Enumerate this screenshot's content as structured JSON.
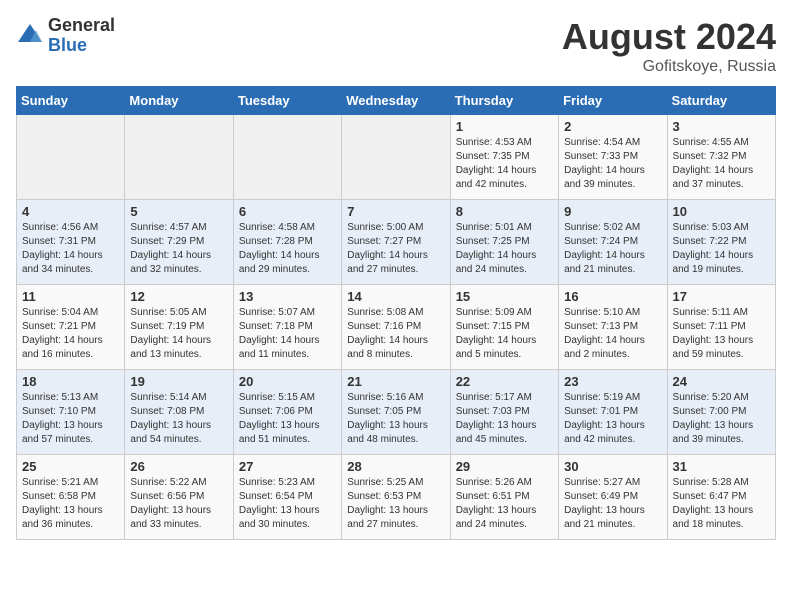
{
  "header": {
    "logo_general": "General",
    "logo_blue": "Blue",
    "month_year": "August 2024",
    "location": "Gofitskoye, Russia"
  },
  "weekdays": [
    "Sunday",
    "Monday",
    "Tuesday",
    "Wednesday",
    "Thursday",
    "Friday",
    "Saturday"
  ],
  "weeks": [
    [
      {
        "day": "",
        "empty": true
      },
      {
        "day": "",
        "empty": true
      },
      {
        "day": "",
        "empty": true
      },
      {
        "day": "",
        "empty": true
      },
      {
        "day": "1",
        "sunrise": "4:53 AM",
        "sunset": "7:35 PM",
        "daylight": "14 hours and 42 minutes."
      },
      {
        "day": "2",
        "sunrise": "4:54 AM",
        "sunset": "7:33 PM",
        "daylight": "14 hours and 39 minutes."
      },
      {
        "day": "3",
        "sunrise": "4:55 AM",
        "sunset": "7:32 PM",
        "daylight": "14 hours and 37 minutes."
      }
    ],
    [
      {
        "day": "4",
        "sunrise": "4:56 AM",
        "sunset": "7:31 PM",
        "daylight": "14 hours and 34 minutes."
      },
      {
        "day": "5",
        "sunrise": "4:57 AM",
        "sunset": "7:29 PM",
        "daylight": "14 hours and 32 minutes."
      },
      {
        "day": "6",
        "sunrise": "4:58 AM",
        "sunset": "7:28 PM",
        "daylight": "14 hours and 29 minutes."
      },
      {
        "day": "7",
        "sunrise": "5:00 AM",
        "sunset": "7:27 PM",
        "daylight": "14 hours and 27 minutes."
      },
      {
        "day": "8",
        "sunrise": "5:01 AM",
        "sunset": "7:25 PM",
        "daylight": "14 hours and 24 minutes."
      },
      {
        "day": "9",
        "sunrise": "5:02 AM",
        "sunset": "7:24 PM",
        "daylight": "14 hours and 21 minutes."
      },
      {
        "day": "10",
        "sunrise": "5:03 AM",
        "sunset": "7:22 PM",
        "daylight": "14 hours and 19 minutes."
      }
    ],
    [
      {
        "day": "11",
        "sunrise": "5:04 AM",
        "sunset": "7:21 PM",
        "daylight": "14 hours and 16 minutes."
      },
      {
        "day": "12",
        "sunrise": "5:05 AM",
        "sunset": "7:19 PM",
        "daylight": "14 hours and 13 minutes."
      },
      {
        "day": "13",
        "sunrise": "5:07 AM",
        "sunset": "7:18 PM",
        "daylight": "14 hours and 11 minutes."
      },
      {
        "day": "14",
        "sunrise": "5:08 AM",
        "sunset": "7:16 PM",
        "daylight": "14 hours and 8 minutes."
      },
      {
        "day": "15",
        "sunrise": "5:09 AM",
        "sunset": "7:15 PM",
        "daylight": "14 hours and 5 minutes."
      },
      {
        "day": "16",
        "sunrise": "5:10 AM",
        "sunset": "7:13 PM",
        "daylight": "14 hours and 2 minutes."
      },
      {
        "day": "17",
        "sunrise": "5:11 AM",
        "sunset": "7:11 PM",
        "daylight": "13 hours and 59 minutes."
      }
    ],
    [
      {
        "day": "18",
        "sunrise": "5:13 AM",
        "sunset": "7:10 PM",
        "daylight": "13 hours and 57 minutes."
      },
      {
        "day": "19",
        "sunrise": "5:14 AM",
        "sunset": "7:08 PM",
        "daylight": "13 hours and 54 minutes."
      },
      {
        "day": "20",
        "sunrise": "5:15 AM",
        "sunset": "7:06 PM",
        "daylight": "13 hours and 51 minutes."
      },
      {
        "day": "21",
        "sunrise": "5:16 AM",
        "sunset": "7:05 PM",
        "daylight": "13 hours and 48 minutes."
      },
      {
        "day": "22",
        "sunrise": "5:17 AM",
        "sunset": "7:03 PM",
        "daylight": "13 hours and 45 minutes."
      },
      {
        "day": "23",
        "sunrise": "5:19 AM",
        "sunset": "7:01 PM",
        "daylight": "13 hours and 42 minutes."
      },
      {
        "day": "24",
        "sunrise": "5:20 AM",
        "sunset": "7:00 PM",
        "daylight": "13 hours and 39 minutes."
      }
    ],
    [
      {
        "day": "25",
        "sunrise": "5:21 AM",
        "sunset": "6:58 PM",
        "daylight": "13 hours and 36 minutes."
      },
      {
        "day": "26",
        "sunrise": "5:22 AM",
        "sunset": "6:56 PM",
        "daylight": "13 hours and 33 minutes."
      },
      {
        "day": "27",
        "sunrise": "5:23 AM",
        "sunset": "6:54 PM",
        "daylight": "13 hours and 30 minutes."
      },
      {
        "day": "28",
        "sunrise": "5:25 AM",
        "sunset": "6:53 PM",
        "daylight": "13 hours and 27 minutes."
      },
      {
        "day": "29",
        "sunrise": "5:26 AM",
        "sunset": "6:51 PM",
        "daylight": "13 hours and 24 minutes."
      },
      {
        "day": "30",
        "sunrise": "5:27 AM",
        "sunset": "6:49 PM",
        "daylight": "13 hours and 21 minutes."
      },
      {
        "day": "31",
        "sunrise": "5:28 AM",
        "sunset": "6:47 PM",
        "daylight": "13 hours and 18 minutes."
      }
    ]
  ]
}
